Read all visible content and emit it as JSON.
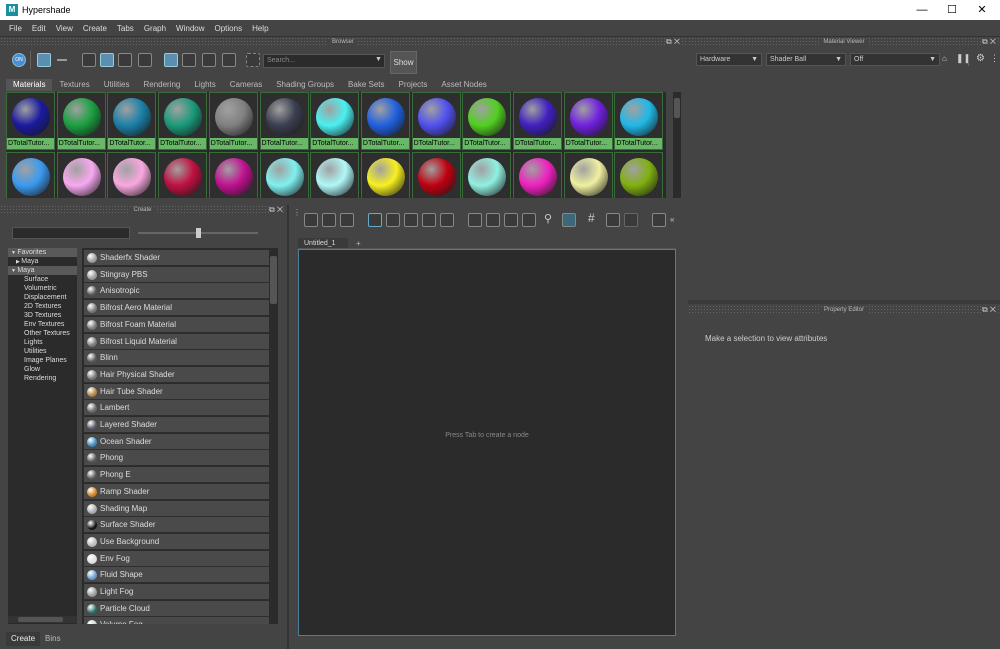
{
  "window": {
    "title": "Hypershade",
    "app_icon_letter": "M",
    "minimize": "—",
    "maximize": "☐",
    "close": "✕"
  },
  "menubar": [
    "File",
    "Edit",
    "View",
    "Create",
    "Tabs",
    "Graph",
    "Window",
    "Options",
    "Help"
  ],
  "browser": {
    "header": "Browser",
    "search_placeholder": "Search...",
    "show_label": "Show",
    "tabs": [
      "Materials",
      "Textures",
      "Utilities",
      "Rendering",
      "Lights",
      "Cameras",
      "Shading Groups",
      "Bake Sets",
      "Projects",
      "Asset Nodes"
    ],
    "swatch_label": "DTotalTutor...",
    "row1_colors": [
      "#1a1aa0",
      "#1aa040",
      "#1a80a8",
      "#1a9a7a",
      "#808080",
      "#3a3f50",
      "#4af0f0",
      "#2060e0",
      "#5050f0",
      "#50d020",
      "#4020c0",
      "#7020e0",
      "#20b8e8"
    ],
    "row2_colors": [
      "#3a9af0",
      "#f8a8f0",
      "#f8a8e0",
      "#c01040",
      "#c01090",
      "#80f0f0",
      "#b0f8f8",
      "#f8f020",
      "#c00010",
      "#90f0e0",
      "#f020c0",
      "#f0f0a0",
      "#80b010"
    ]
  },
  "create_panel": {
    "header": "Create",
    "tree": [
      {
        "label": "Favorites",
        "level": 0,
        "expanded": true
      },
      {
        "label": "Maya",
        "level": 1,
        "expanded": false
      },
      {
        "label": "Maya",
        "level": 0,
        "expanded": true,
        "selected": true
      },
      {
        "label": "Surface",
        "level": 2
      },
      {
        "label": "Volumetric",
        "level": 2
      },
      {
        "label": "Displacement",
        "level": 2
      },
      {
        "label": "2D Textures",
        "level": 2
      },
      {
        "label": "3D Textures",
        "level": 2
      },
      {
        "label": "Env Textures",
        "level": 2
      },
      {
        "label": "Other Textures",
        "level": 2
      },
      {
        "label": "Lights",
        "level": 2
      },
      {
        "label": "Utilities",
        "level": 2
      },
      {
        "label": "Image Planes",
        "level": 2
      },
      {
        "label": "Glow",
        "level": 2
      },
      {
        "label": "Rendering",
        "level": 2
      }
    ],
    "list": [
      {
        "label": "Shaderfx Shader",
        "color": "#9a9a9a"
      },
      {
        "label": "Stingray PBS",
        "color": "#9a9a9a"
      },
      {
        "label": "Anisotropic",
        "color": "#555"
      },
      {
        "label": "Bifrost Aero Material",
        "color": "#777"
      },
      {
        "label": "Bifrost Foam Material",
        "color": "#777"
      },
      {
        "label": "Bifrost Liquid Material",
        "color": "#777"
      },
      {
        "label": "Blinn",
        "color": "#555"
      },
      {
        "label": "Hair Physical Shader",
        "color": "#777"
      },
      {
        "label": "Hair Tube Shader",
        "color": "#b08040"
      },
      {
        "label": "Lambert",
        "color": "#666"
      },
      {
        "label": "Layered Shader",
        "color": "#556"
      },
      {
        "label": "Ocean Shader",
        "color": "#3a8ac0"
      },
      {
        "label": "Phong",
        "color": "#555"
      },
      {
        "label": "Phong E",
        "color": "#555"
      },
      {
        "label": "Ramp Shader",
        "color": "#d08020"
      },
      {
        "label": "Shading Map",
        "color": "#aaa"
      },
      {
        "label": "Surface Shader",
        "color": "#111"
      },
      {
        "label": "Use Background",
        "color": "#bbb"
      },
      {
        "label": "Env Fog",
        "color": "#ddd"
      },
      {
        "label": "Fluid Shape",
        "color": "#6a9ad0"
      },
      {
        "label": "Light Fog",
        "color": "#999"
      },
      {
        "label": "Particle Cloud",
        "color": "#2a6a6a"
      },
      {
        "label": "Volume Fog",
        "color": "#ccc"
      }
    ],
    "bottom_tabs": [
      "Create",
      "Bins"
    ]
  },
  "node_editor": {
    "tab_label": "Untitled_1",
    "add_tab": "+",
    "canvas_message": "Press Tab to create a node"
  },
  "material_viewer": {
    "header": "Material Viewer",
    "renderer": "Hardware",
    "shape": "Shader Ball",
    "env": "Off"
  },
  "property_editor": {
    "header": "Property Editor",
    "message": "Make a selection to view attributes"
  }
}
